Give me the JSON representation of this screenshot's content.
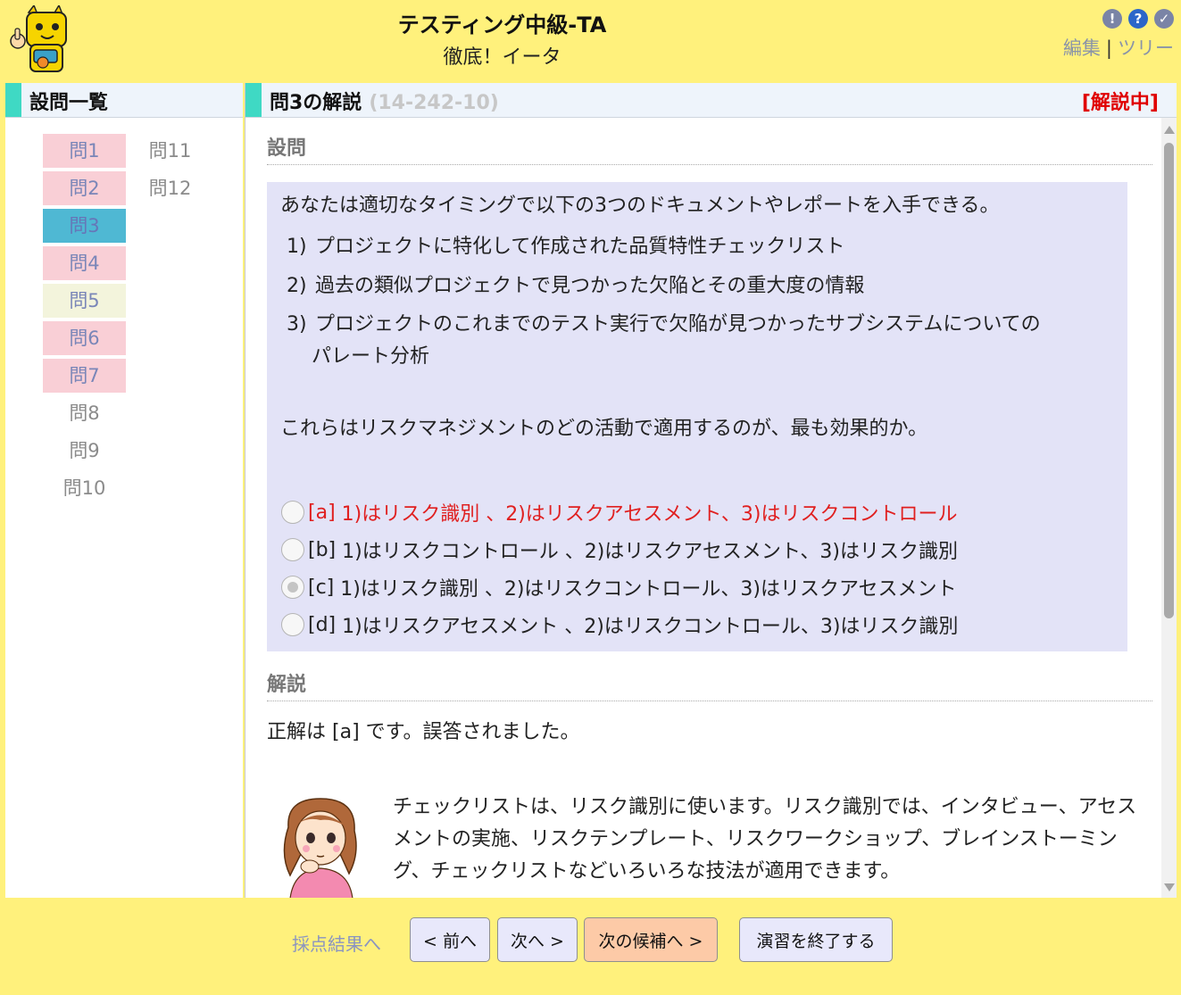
{
  "header": {
    "title": "テスティング中級-TA",
    "subtitle": "徹底！イータ",
    "icons": [
      {
        "name": "info-icon",
        "glyph": "!",
        "color": "#7a84a6"
      },
      {
        "name": "help-icon",
        "glyph": "?",
        "color": "#2b66c9"
      },
      {
        "name": "check-icon",
        "glyph": "✓",
        "color": "#7a84a6"
      }
    ],
    "link_edit": "編集",
    "separator": "|",
    "link_tree": "ツリー"
  },
  "left_panel": {
    "title": "設問一覧",
    "questions": [
      {
        "label": "問1",
        "state": "pink"
      },
      {
        "label": "問2",
        "state": "pink"
      },
      {
        "label": "問3",
        "state": "current"
      },
      {
        "label": "問4",
        "state": "pink"
      },
      {
        "label": "問5",
        "state": "yellow"
      },
      {
        "label": "問6",
        "state": "pink"
      },
      {
        "label": "問7",
        "state": "pink"
      },
      {
        "label": "問8",
        "state": "plain"
      },
      {
        "label": "問9",
        "state": "plain"
      },
      {
        "label": "問10",
        "state": "plain"
      },
      {
        "label": "問11",
        "state": "plain"
      },
      {
        "label": "問12",
        "state": "plain"
      }
    ]
  },
  "main": {
    "title": "問3の解説",
    "question_id": "(14-242-10)",
    "status": "[解説中]",
    "section_question": "設問",
    "intro": "あなたは適切なタイミングで以下の3つのドキュメントやレポートを入手できる。",
    "items": [
      {
        "num": "1)",
        "text": "プロジェクトに特化して作成された品質特性チェックリスト",
        "cont": ""
      },
      {
        "num": "2)",
        "text": "過去の類似プロジェクトで見つかった欠陥とその重大度の情報",
        "cont": ""
      },
      {
        "num": "3)",
        "text": "プロジェクトのこれまでのテスト実行で欠陥が見つかったサブシステムについての",
        "cont": "パレート分析"
      }
    ],
    "ask": "これらはリスクマネジメントのどの活動で適用するのが、最も効果的か。",
    "options": [
      {
        "key": "[a]",
        "text": "1)はリスク識別 、2)はリスクアセスメント、3)はリスクコントロール",
        "correct": true,
        "selected": false
      },
      {
        "key": "[b]",
        "text": "1)はリスクコントロール 、2)はリスクアセスメント、3)はリスク識別",
        "correct": false,
        "selected": false
      },
      {
        "key": "[c]",
        "text": "1)はリスク識別 、2)はリスクコントロール、3)はリスクアセスメント",
        "correct": false,
        "selected": true
      },
      {
        "key": "[d]",
        "text": "1)はリスクアセスメント 、2)はリスクコントロール、3)はリスク識別",
        "correct": false,
        "selected": false
      }
    ],
    "section_explain": "解説",
    "answer_prefix": "正解は",
    "answer_key": "[a]",
    "answer_suffix": "です。誤答されました。",
    "explanation": "チェックリストは、リスク識別に使います。リスク識別では、インタビュー、アセスメントの実施、リスクテンプレート、リスクワークショップ、ブレインストーミング、チェックリストなどいろいろな技法が適用できます。"
  },
  "footer": {
    "results_link": "採点結果へ",
    "prev_button": "< 前へ",
    "next_button": "次へ >",
    "next_candidate_button": "次の候補へ >",
    "end_button": "演習を終了する"
  }
}
